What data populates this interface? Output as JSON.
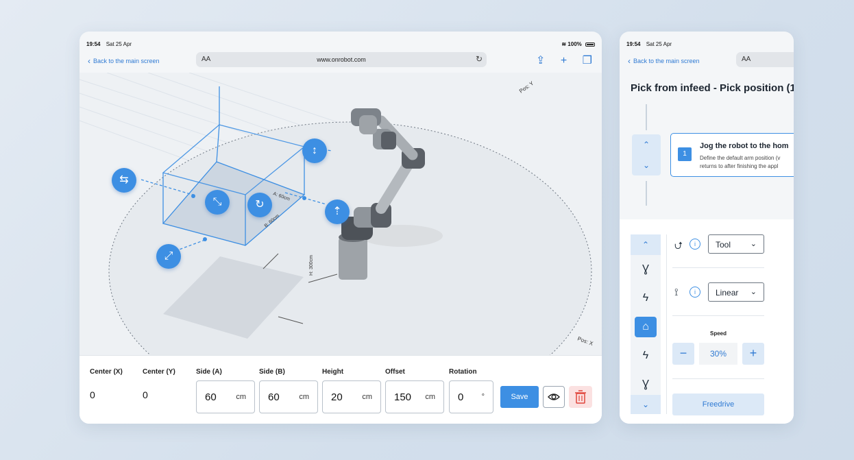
{
  "status": {
    "time": "19:54",
    "date": "Sat 25 Apr",
    "battery": "100%"
  },
  "nav": {
    "back_label": "Back to the main screen",
    "aa": "AA",
    "url": "www.onrobot.com"
  },
  "viewport": {
    "pos_y": "Pos: Y",
    "pos_x": "Pos: X",
    "dim_a": "A: 60cm",
    "dim_b": "B: 60cm",
    "dim_h": "H: 300cm"
  },
  "properties": {
    "center_x": {
      "label": "Center (X)",
      "value": "0"
    },
    "center_y": {
      "label": "Center (Y)",
      "value": "0"
    },
    "side_a": {
      "label": "Side (A)",
      "value": "60",
      "unit": "cm"
    },
    "side_b": {
      "label": "Side (B)",
      "value": "60",
      "unit": "cm"
    },
    "height": {
      "label": "Height",
      "value": "20",
      "unit": "cm"
    },
    "offset": {
      "label": "Offset",
      "value": "150",
      "unit": "cm"
    },
    "rotation": {
      "label": "Rotation",
      "value": "0",
      "unit": "°"
    },
    "save_label": "Save"
  },
  "right_panel": {
    "title": "Pick from infeed - Pick position (1",
    "step": {
      "number": "1",
      "title": "Jog the robot to the hom",
      "desc_line1": "Define the default arm position (v",
      "desc_line2": "returns to after finishing the appl"
    },
    "frame_select": "Tool",
    "motion_select": "Linear",
    "speed_label": "Speed",
    "speed_value": "30%",
    "freedrive_label": "Freedrive"
  },
  "colors": {
    "accent": "#3d8fe3",
    "link": "#2f7ad3",
    "delete_bg": "#fbe1e1",
    "delete_icon": "#e0443a"
  }
}
